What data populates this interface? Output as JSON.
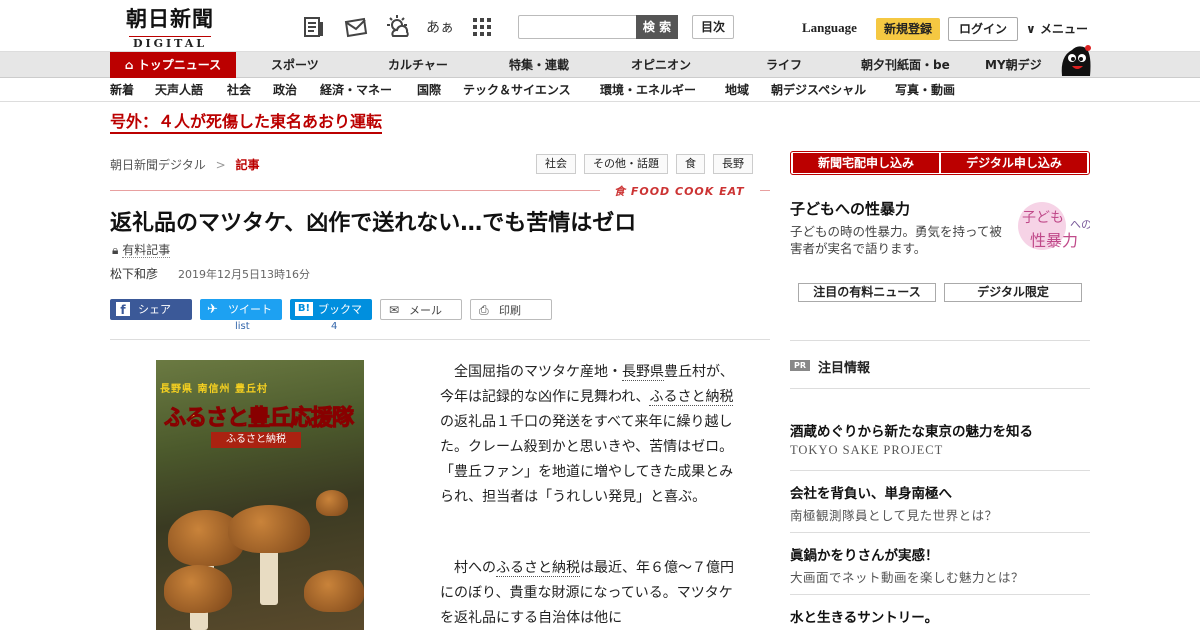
{
  "header": {
    "logo_jp": "朝日新聞",
    "logo_en": "DIGITAL",
    "icons": [
      "paper-icon",
      "newsletter-icon",
      "weather-icon",
      "font-size-icon",
      "apps-grid-icon"
    ],
    "font_size_label": "あぁ",
    "search_button": "検 索",
    "index_button": "目次",
    "language": "Language",
    "register": "新規登録",
    "login": "ログイン",
    "menu": "メニュー"
  },
  "nav_main": [
    "トップニュース",
    "スポーツ",
    "カルチャー",
    "特集・連載",
    "オピニオン",
    "ライフ",
    "朝夕刊紙面・be",
    "MY朝デジ"
  ],
  "nav_sub": [
    "新着",
    "天声人語",
    "社会",
    "政治",
    "経済・マネー",
    "国際",
    "テック＆サイエンス",
    "環境・エネルギー",
    "地域",
    "朝デジスペシャル",
    "写真・動画"
  ],
  "breaking": "号外：４人が死傷した東名あおり運転",
  "breadcrumb": {
    "home": "朝日新聞デジタル",
    "sep": ">",
    "current": "記事"
  },
  "tags": [
    "社会",
    "その他・話題",
    "食",
    "長野"
  ],
  "section_label": "食 FOOD COOK EAT",
  "article": {
    "title": "返礼品のマツタケ、凶作で送れない…でも苦情はゼロ",
    "paid": "有料記事",
    "author": "松下和彦",
    "date": "2019年12月5日13時16分",
    "p1_a": "全国屈指のマツタケ産地・",
    "p1_link1": "長野県",
    "p1_b": "豊丘村が、今年は記録的な凶作に見舞われ、",
    "p1_link2": "ふるさと納税",
    "p1_c": "の返礼品１千口の発送をすべて来年に繰り越した。クレーム殺到かと思いきや、苦情はゼロ。「豊丘ファン」を地道に増やしてきた成果とみられ、担当者は「うれしい発見」と喜ぶ。",
    "p2_a": "村への",
    "p2_link": "ふるさと納税",
    "p2_b": "は最近、年６億～７億円にのぼり、貴重な財源になっている。マツタケを返礼品にする自治体は他に"
  },
  "photo": {
    "line1": "長野県 南信州 豊丘村",
    "line2": "ふるさと豊丘応援隊",
    "line3": "ふるさと納税"
  },
  "share": {
    "facebook": "シェア",
    "twitter": "ツイート",
    "twitter_count": "list",
    "hatena": "ブックマーク",
    "hatena_count": "4",
    "mail": "メール",
    "print": "印刷"
  },
  "sidebar": {
    "subscribe_paper": "新聞宅配申し込み",
    "subscribe_digital": "デジタル申し込み",
    "feature_title": "子どもへの性暴力",
    "feature_desc": "子どもの時の性暴力。勇気を持って被害者が実名で語ります。",
    "feature_img_text": "子どもへの性暴力",
    "tab1": "注目の有料ニュース",
    "tab2": "デジタル限定",
    "pr_badge": "PR",
    "pr_title": "注目情報",
    "items": [
      {
        "title": "酒蔵めぐりから新たな東京の魅力を知る",
        "sub": "TOKYO SAKE PROJECT"
      },
      {
        "title": "会社を背負い、単身南極へ",
        "sub": "南極観測隊員として見た世界とは？"
      },
      {
        "title": "眞鍋かをりさんが実感！",
        "sub": "大画面でネット動画を楽しむ魅力とは？"
      },
      {
        "title": "水と生きるサントリー。",
        "sub": ""
      }
    ]
  },
  "colors": {
    "brand_red": "#bb0000",
    "register_yellow": "#f5c842",
    "facebook": "#3b5998",
    "twitter": "#1da1f2",
    "hatena": "#008fde"
  }
}
